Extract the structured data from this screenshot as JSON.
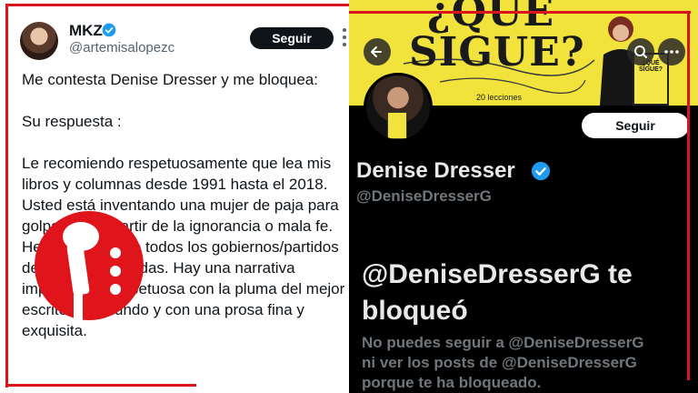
{
  "tweet": {
    "author_name": "MKZ",
    "author_handle": "@artemisalopezc",
    "follow_label": "Seguir",
    "text": "Me contesta Denise Dresser y me bloquea:\n\nSu respuesta :\n\nLe recomiendo respetuosamente que lea mis libros y columnas desde 1991 hasta el 2018. Usted está inventando una mujer de paja para golpearme a partir de la ignorancia o mala fe. He sido crítica de todos los gobiernos/partidos desde hace décadas. Hay una narrativa impecable y respetuosa con la pluma del mejor escritor del mundo y con una prosa fina y exquisita."
  },
  "profile": {
    "banner_title": "¿QUÉ\nSIGUE?",
    "banner_subtitle": "20 lecciones",
    "banner_book_label": "¿QUÉ SIGUE?",
    "display_name": "Denise Dresser",
    "handle": "@DeniseDresserG",
    "follow_label": "Seguir",
    "blocked_title": "@DeniseDresserG te\nbloqueó",
    "blocked_message": "No puedes seguir a @DeniseDresserG\nni ver los posts de @DeniseDresserG\nporque te ha bloqueado."
  },
  "icons": {
    "back": "arrow-left-icon",
    "search": "search-icon",
    "more": "more-icon",
    "verified": "verified-badge-icon",
    "logo": "microphone-logo"
  },
  "colors": {
    "accent_red": "#d9151b",
    "verified_blue": "#1d9bf0",
    "banner_yellow": "#f1e33c"
  }
}
